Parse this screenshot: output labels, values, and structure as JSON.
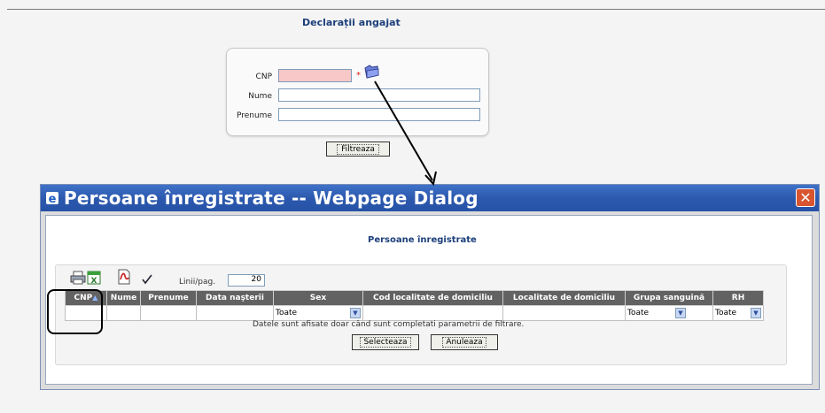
{
  "page": {
    "title": "Declarații angajat"
  },
  "filter": {
    "cnp_label": "CNP",
    "cnp_value": "",
    "required_mark": "*",
    "nume_label": "Nume",
    "nume_value": "",
    "prenume_label": "Prenume",
    "prenume_value": "",
    "filter_button": "Filtreaza"
  },
  "dialog": {
    "title": "Persoane înregistrate -- Webpage Dialog",
    "close": "✕",
    "subtitle": "Persoane înregistrate",
    "rows_label": "Linii/pag.",
    "rows_value": "20",
    "columns": [
      "CNP",
      "Nume",
      "Prenume",
      "Data naşterii",
      "Sex",
      "Cod localitate de domiciliu",
      "Localitate de domiciliu",
      "Grupa sanguină",
      "RH"
    ],
    "sort_indicator": "▲",
    "filters": {
      "sex": "Toate",
      "grupa": "Toate",
      "rh": "Toate"
    },
    "note": "Datele sunt afisate doar când sunt completati parametrii de filtrare.",
    "select_button": "Selecteaza",
    "cancel_button": "Anuleaza"
  },
  "colors": {
    "titlebar": "#2c59ae",
    "header": "#626262",
    "accent": "#1c3f7a",
    "required_field": "#f8c8c8"
  }
}
